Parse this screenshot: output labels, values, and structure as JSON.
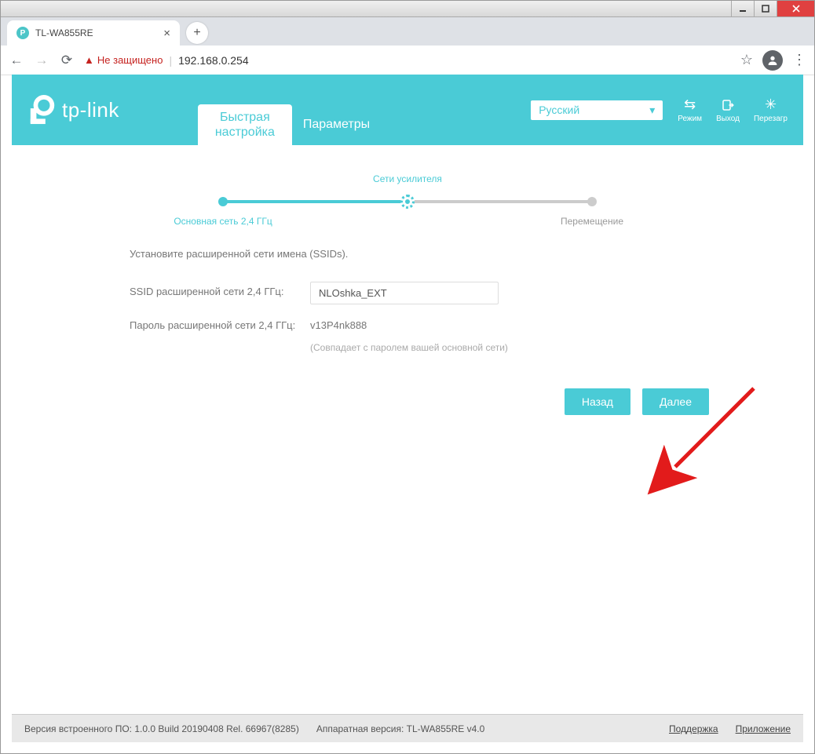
{
  "window": {
    "title": "TL-WA855RE"
  },
  "browser": {
    "tab_title": "TL-WA855RE",
    "security_label": "Не защищено",
    "url": "192.168.0.254"
  },
  "header": {
    "logo_text": "tp-link",
    "tabs": {
      "quick": "Быстрая настройка",
      "params": "Параметры"
    },
    "language": "Русский",
    "actions": {
      "mode": "Режим",
      "logout": "Выход",
      "reboot": "Перезагр"
    }
  },
  "wizard": {
    "steps": {
      "s1": "Основная сеть 2,4 ГГц",
      "s2": "Сети усилителя",
      "s3": "Перемещение"
    },
    "instruction": "Установите расширенной сети имена (SSIDs).",
    "labels": {
      "ssid": "SSID расширенной сети 2,4 ГГц:",
      "password": "Пароль расширенной сети 2,4 ГГц:"
    },
    "values": {
      "ssid": "NLOshka_EXT",
      "password": "v13P4nk888"
    },
    "hint": "(Совпадает с паролем вашей основной сети)",
    "buttons": {
      "back": "Назад",
      "next": "Далее"
    }
  },
  "footer": {
    "fw": "Версия встроенного ПО: 1.0.0 Build 20190408 Rel. 66967(8285)",
    "hw": "Аппаратная версия: TL-WA855RE v4.0",
    "support": "Поддержка",
    "app": "Приложение"
  }
}
